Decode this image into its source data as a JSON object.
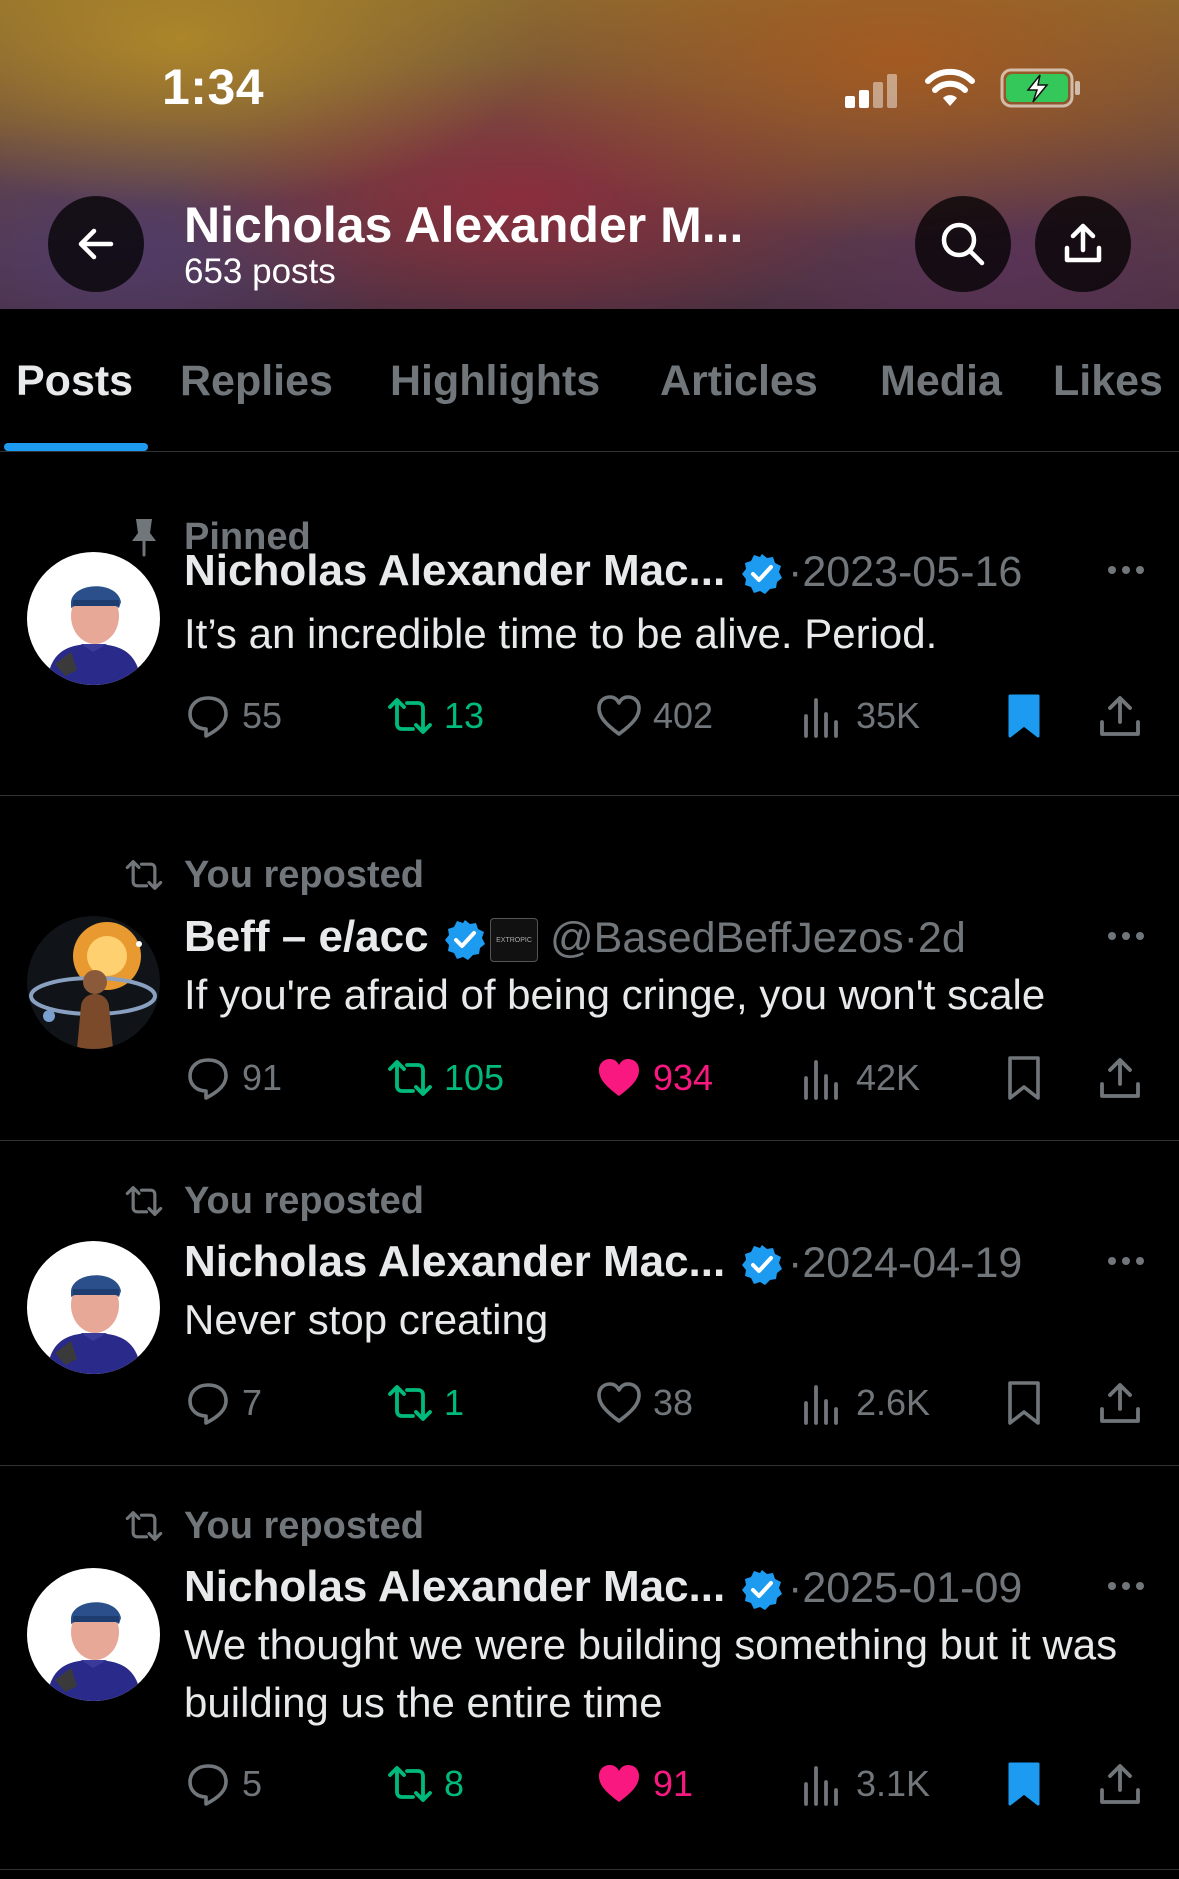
{
  "status_bar": {
    "time": "1:34"
  },
  "header": {
    "title": "Nicholas Alexander M...",
    "subtitle": "653 posts"
  },
  "tabs": [
    {
      "label": "Posts",
      "active": true
    },
    {
      "label": "Replies",
      "active": false
    },
    {
      "label": "Highlights",
      "active": false
    },
    {
      "label": "Articles",
      "active": false
    },
    {
      "label": "Media",
      "active": false
    },
    {
      "label": "Likes",
      "active": false
    }
  ],
  "colors": {
    "accent": "#1d9bf0",
    "repost": "#00ba7c",
    "like": "#f91880",
    "muted": "#71767b",
    "text": "#e7e9ea",
    "background": "#000000"
  },
  "posts": [
    {
      "context_icon": "pin-icon",
      "context": "Pinned",
      "author": "Nicholas Alexander Mac...",
      "verified": true,
      "meta": "·2023-05-16",
      "text": "It’s an incredible time to be alive. Period.",
      "replies": "55",
      "reposts": "13",
      "reposted": true,
      "likes": "402",
      "liked": false,
      "views": "35K",
      "bookmarked": true
    },
    {
      "context_icon": "repost-icon",
      "context": "You reposted",
      "author": "Beff – e/acc",
      "verified": true,
      "affiliate_badge": "EXTROPIC",
      "meta": "@BasedBeffJezos·2d",
      "text": "If you're afraid of being cringe, you won't scale",
      "replies": "91",
      "reposts": "105",
      "reposted": true,
      "likes": "934",
      "liked": true,
      "views": "42K",
      "bookmarked": false
    },
    {
      "context_icon": "repost-icon",
      "context": "You reposted",
      "author": "Nicholas Alexander Mac...",
      "verified": true,
      "meta": "·2024-04-19",
      "text": "Never stop creating",
      "replies": "7",
      "reposts": "1",
      "reposted": true,
      "likes": "38",
      "liked": false,
      "views": "2.6K",
      "bookmarked": false
    },
    {
      "context_icon": "repost-icon",
      "context": "You reposted",
      "author": "Nicholas Alexander Mac...",
      "verified": true,
      "meta": "·2025-01-09",
      "text": "We thought we were building something but it was building us the entire time",
      "replies": "5",
      "reposts": "8",
      "reposted": true,
      "likes": "91",
      "liked": true,
      "views": "3.1K",
      "bookmarked": true
    }
  ]
}
